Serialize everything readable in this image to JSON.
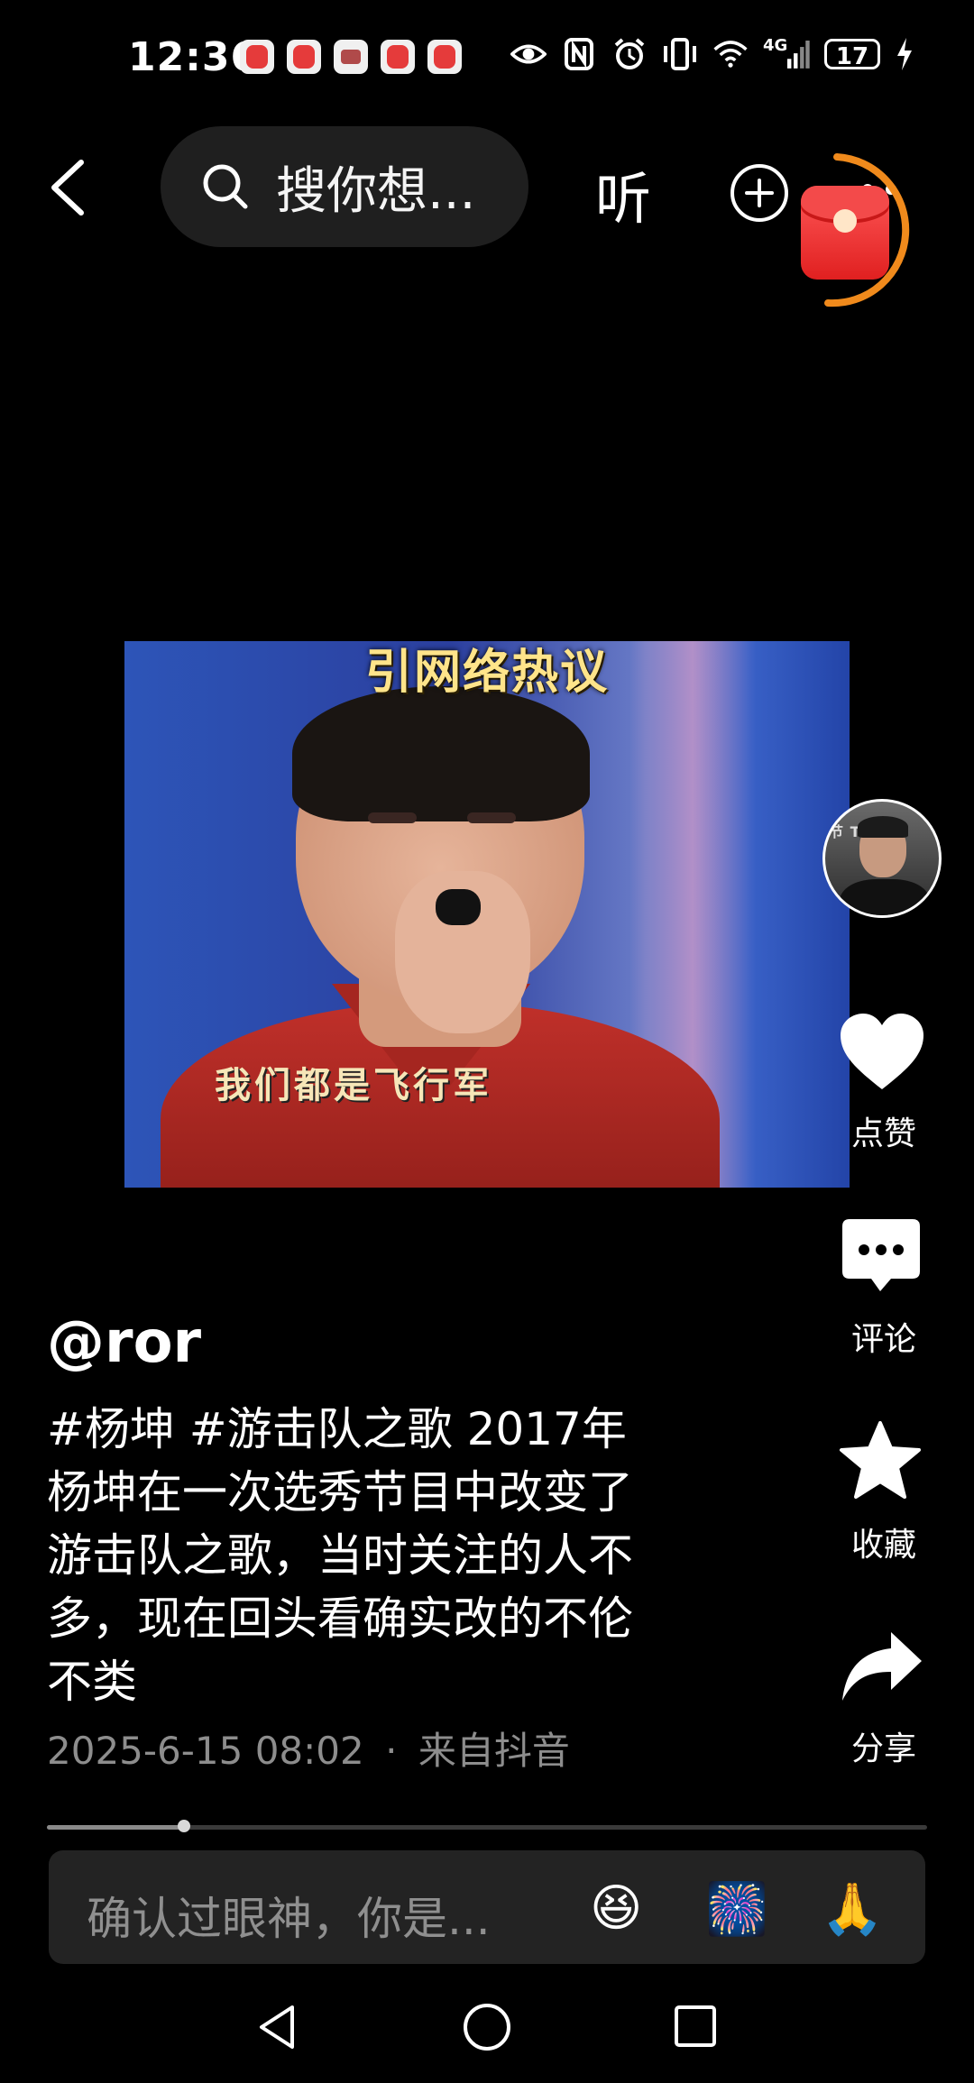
{
  "status_bar": {
    "time": "12:36",
    "network": "4G",
    "battery": "17"
  },
  "top_bar": {
    "search_placeholder": "搜你想...",
    "listen_label": "听"
  },
  "video": {
    "caption_top": "引网络热议",
    "caption_subtitle": "我们都是飞行军"
  },
  "right_rail": {
    "like_label": "点赞",
    "comment_label": "评论",
    "favorite_label": "收藏",
    "share_label": "分享"
  },
  "post": {
    "author": "@ror",
    "desc_lines": [
      "#杨坤 #游击队之歌 2017年",
      "杨坤在一次选秀节目中改变了",
      "游击队之歌，当时关注的人不",
      "多，现在回头看确实改的不伦",
      "不类"
    ],
    "datetime": "2025-6-15 08:02",
    "separator": "·",
    "source": "来自抖音"
  },
  "playback": {
    "progress_fraction": 0.156
  },
  "comment_bar": {
    "placeholder": "确认过眼神，你是...",
    "emojis": [
      "😆",
      "🎆",
      "🙏"
    ]
  },
  "colors": {
    "background": "#000000",
    "accent_orange": "#f08a1c",
    "redpack": "#e53b3b"
  }
}
